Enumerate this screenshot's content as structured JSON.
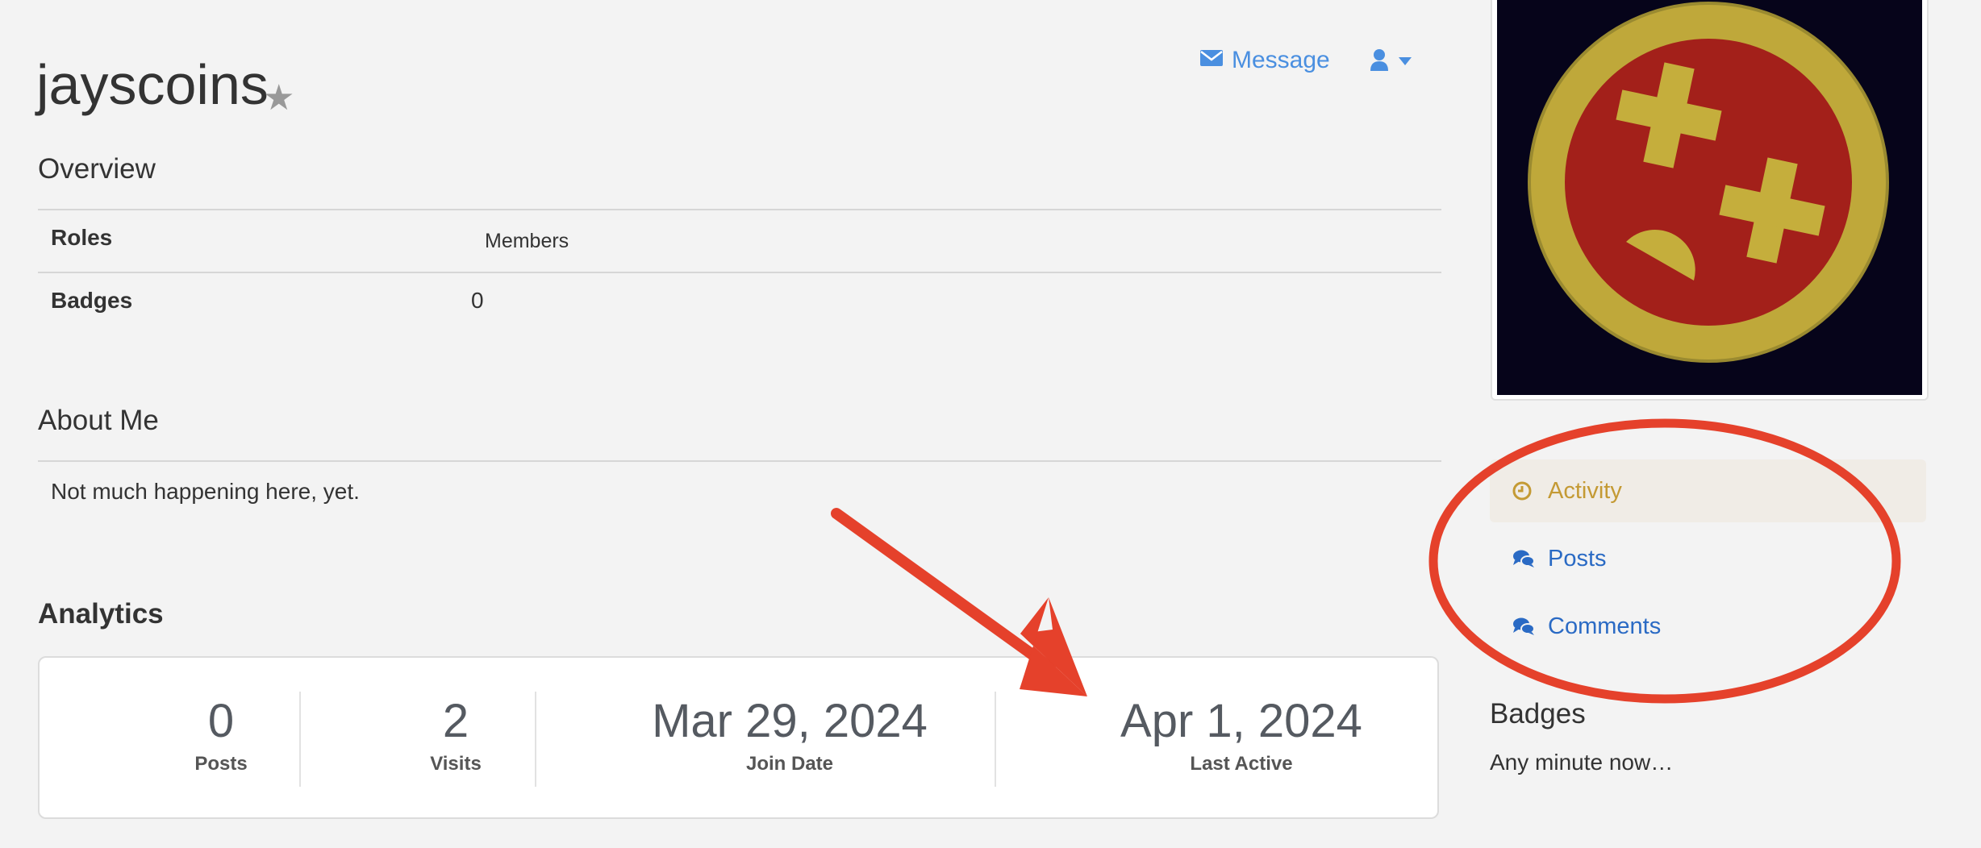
{
  "profile": {
    "username": "jayscoins",
    "message_label": "Message"
  },
  "overview": {
    "title": "Overview",
    "rows": [
      {
        "label": "Roles",
        "value": "Members"
      },
      {
        "label": "Badges",
        "value": "0"
      }
    ]
  },
  "about": {
    "title": "About Me",
    "text": "Not much happening here, yet."
  },
  "analytics": {
    "title": "Analytics",
    "stats": [
      {
        "value": "0",
        "label": "Posts"
      },
      {
        "value": "2",
        "label": "Visits"
      },
      {
        "value": "Mar 29, 2024",
        "label": "Join Date"
      },
      {
        "value": "Apr 1, 2024",
        "label": "Last Active"
      }
    ]
  },
  "sidebar": {
    "nav": [
      {
        "label": "Activity",
        "icon": "clock-icon",
        "active": true
      },
      {
        "label": "Posts",
        "icon": "comments-icon",
        "active": false
      },
      {
        "label": "Comments",
        "icon": "comments-icon",
        "active": false
      }
    ],
    "badges_title": "Badges",
    "badges_text": "Any minute now…"
  },
  "colors": {
    "link": "#4a8fe0",
    "nav_link": "#2a6ac4",
    "active": "#c49a34",
    "annotation": "#e5412b"
  }
}
